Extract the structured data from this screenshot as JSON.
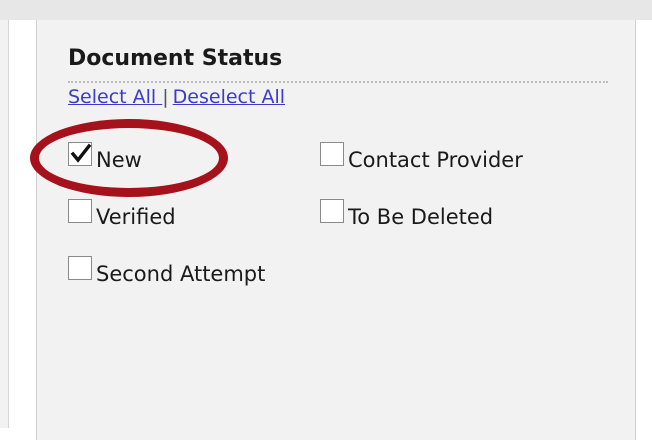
{
  "section": {
    "title": "Document Status",
    "select_all_label": "Select All ",
    "separator": "|",
    "deselect_all_label": "Deselect All"
  },
  "checkboxes": [
    {
      "label": "New",
      "checked": true
    },
    {
      "label": "Contact Provider",
      "checked": false
    },
    {
      "label": "Verified",
      "checked": false
    },
    {
      "label": "To Be Deleted",
      "checked": false
    },
    {
      "label": "Second Attempt",
      "checked": false
    }
  ],
  "annotation": {
    "ring_color": "#a5121b",
    "target": "New"
  },
  "colors": {
    "link": "#3a3acb",
    "panel_bg": "#f2f2f2",
    "top_strip": "#e7e7e7"
  }
}
